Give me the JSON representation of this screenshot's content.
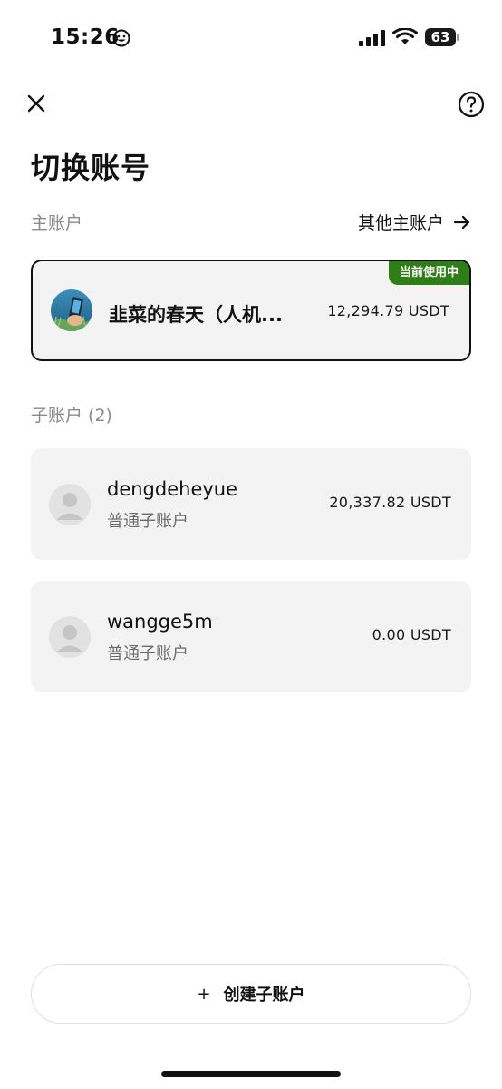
{
  "status_bar": {
    "time": "15:26",
    "battery": "63"
  },
  "header": {
    "close_icon": "close-icon",
    "help_icon": "question-circle-icon",
    "title": "切换账号"
  },
  "main_section": {
    "label": "主账户",
    "other_link": "其他主账户",
    "account": {
      "name": "韭菜的春天（人机...",
      "balance": "12,294.79 USDT",
      "badge": "当前使用中"
    }
  },
  "sub_section": {
    "label": "子账户 (2)",
    "accounts": [
      {
        "name": "dengdeheyue",
        "type": "普通子账户",
        "balance": "20,337.82 USDT"
      },
      {
        "name": "wangge5m",
        "type": "普通子账户",
        "balance": "0.00 USDT"
      }
    ]
  },
  "footer": {
    "create_plus": "+",
    "create_label": "创建子账户"
  },
  "colors": {
    "badge_green": "#2f7d16",
    "card_bg": "#f3f3f3",
    "muted_text": "#8a8a8a"
  }
}
